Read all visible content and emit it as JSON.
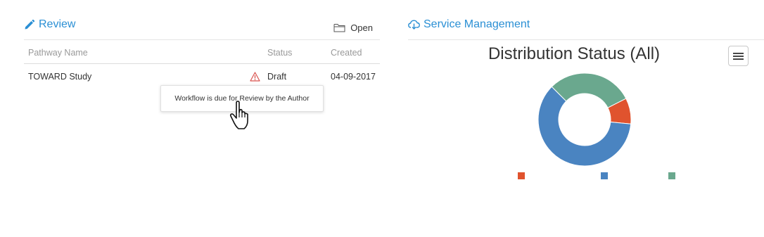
{
  "review": {
    "title": "Review",
    "open_label": "Open",
    "columns": [
      "Pathway Name",
      "Status",
      "Created"
    ],
    "rows": [
      {
        "name": "TOWARD Study",
        "status": "Draft",
        "created": "04-09-2017",
        "warning": true
      }
    ],
    "tooltip": "Workflow is due for Review by the Author"
  },
  "service": {
    "title": "Service Management"
  },
  "chart_data": {
    "type": "pie",
    "title": "Distribution Status (All)",
    "donut": true,
    "series": [
      {
        "color": "#e0532e",
        "value": 9
      },
      {
        "color": "#4a84c1",
        "value": 61
      },
      {
        "color": "#6aa88e",
        "value": 30
      }
    ],
    "legend_colors": [
      "#e0532e",
      "#4a84c1",
      "#6aa88e"
    ],
    "legend": "bottom"
  },
  "colors": {
    "accent": "#2a8fd4",
    "warning": "#d9534f"
  }
}
